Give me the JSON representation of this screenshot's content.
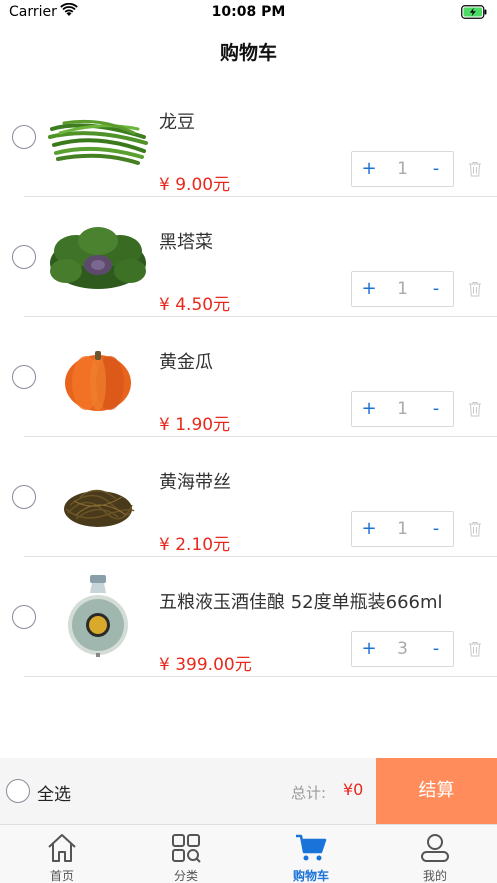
{
  "status_bar": {
    "carrier": "Carrier",
    "time": "10:08 PM",
    "wifi_icon": "wifi-icon",
    "battery_icon": "battery-charging-icon"
  },
  "nav": {
    "title": "购物车"
  },
  "cart": {
    "items": [
      {
        "name": "龙豆",
        "price": "¥ 9.00元",
        "quantity": "1",
        "plus": "+",
        "minus": "-",
        "image": "green-beans"
      },
      {
        "name": "黑塔菜",
        "price": "¥ 4.50元",
        "quantity": "1",
        "plus": "+",
        "minus": "-",
        "image": "tatsoi-greens"
      },
      {
        "name": "黄金瓜",
        "price": "¥ 1.90元",
        "quantity": "1",
        "plus": "+",
        "minus": "-",
        "image": "pumpkin"
      },
      {
        "name": "黄海带丝",
        "price": "¥ 2.10元",
        "quantity": "1",
        "plus": "+",
        "minus": "-",
        "image": "kelp-shreds"
      },
      {
        "name": "五粮液玉酒佳酿 52度单瓶装666ml",
        "price": "¥ 399.00元",
        "quantity": "3",
        "plus": "+",
        "minus": "-",
        "image": "liquor-bottle"
      }
    ]
  },
  "checkout": {
    "select_all_label": "全选",
    "total_label": "总计:",
    "total_value": "¥0",
    "checkout_label": "结算"
  },
  "tabs": [
    {
      "label": "首页",
      "icon": "home-icon",
      "active": false
    },
    {
      "label": "分类",
      "icon": "category-grid-icon",
      "active": false
    },
    {
      "label": "购物车",
      "icon": "cart-icon",
      "active": true
    },
    {
      "label": "我的",
      "icon": "profile-icon",
      "active": false
    }
  ],
  "colors": {
    "accent": "#1a73d9",
    "price": "#e8291c",
    "checkout_button": "#ff8c5a"
  }
}
